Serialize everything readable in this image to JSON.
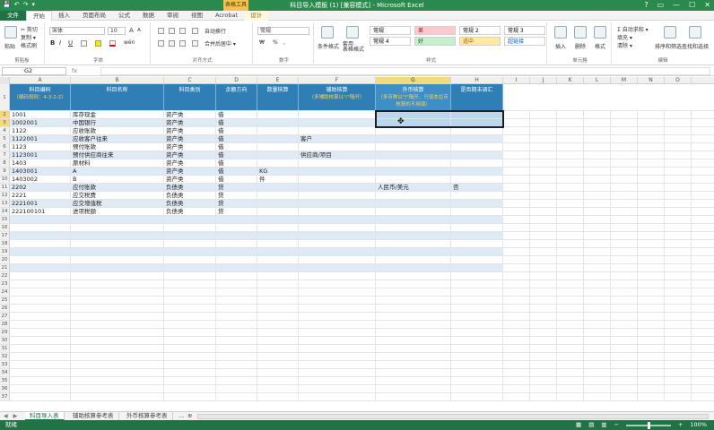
{
  "window": {
    "title": "科目导入模板 (1) [兼容模式] - Microsoft Excel",
    "context_tab_label": "表格工具",
    "controls": [
      "?",
      "▭",
      "—",
      "☐",
      "✕"
    ],
    "qat": [
      "💾",
      "↶",
      "↷",
      "▾"
    ]
  },
  "ribbon_tabs": {
    "file": "文件",
    "items": [
      "开始",
      "插入",
      "页面布局",
      "公式",
      "数据",
      "审阅",
      "视图",
      "Acrobat",
      "设计"
    ],
    "active": "开始"
  },
  "ribbon": {
    "clipboard": {
      "paste": "粘贴",
      "cut": "✂ 剪切",
      "copy": "复制 ▾",
      "format_painter": "格式刷",
      "label": "剪贴板"
    },
    "font": {
      "name": "宋体",
      "size": "10",
      "label": "字体",
      "grow": "A",
      "shrink": "A",
      "bold": "B",
      "italic": "I",
      "underline": "U",
      "wen": "wén"
    },
    "alignment": {
      "wrap": "自动换行",
      "merge": "合并后居中 ▾",
      "label": "对齐方式"
    },
    "number": {
      "format": "常规",
      "label": "数字",
      "percent": "%",
      "comma": ",",
      "currency": "₩"
    },
    "styles": {
      "cond_format": "条件格式",
      "table_format": "套用\n表格格式",
      "cells": [
        {
          "text": "常规",
          "bg": "#ffffff",
          "fg": "#000000"
        },
        {
          "text": "差",
          "bg": "#ffc7ce",
          "fg": "#9c0006"
        },
        {
          "text": "常规 2",
          "bg": "#ffffff",
          "fg": "#000000"
        },
        {
          "text": "常规 3",
          "bg": "#ffffff",
          "fg": "#000000"
        },
        {
          "text": "常规 4",
          "bg": "#ffffff",
          "fg": "#000000"
        },
        {
          "text": "好",
          "bg": "#c6efce",
          "fg": "#006100"
        },
        {
          "text": "适中",
          "bg": "#ffeb9c",
          "fg": "#9c5700"
        },
        {
          "text": "超链接",
          "bg": "#ffffff",
          "fg": "#0563c1"
        }
      ],
      "label": "样式"
    },
    "cells": {
      "insert": "插入",
      "delete": "删除",
      "format": "格式",
      "label": "单元格"
    },
    "editing": {
      "autosum": "Σ 自动求和 ▾",
      "fill": "填充 ▾",
      "clear": "清除 ▾",
      "sort": "排序和筛选",
      "find": "查找和选择",
      "label": "编辑"
    }
  },
  "formula_bar": {
    "name_box": "G2",
    "fx": "fx",
    "value": ""
  },
  "columns": [
    "A",
    "B",
    "C",
    "D",
    "E",
    "F",
    "G",
    "H",
    "I",
    "J",
    "K",
    "L",
    "M",
    "N",
    "O"
  ],
  "selected_column": "G",
  "header_row": {
    "A": {
      "title": "科目编码",
      "sub": "（编码规则：4-3-2-2）"
    },
    "B": {
      "title": "科目名称"
    },
    "C": {
      "title": "科目类别"
    },
    "D": {
      "title": "余额方向"
    },
    "E": {
      "title": "数量核算"
    },
    "F": {
      "title": "辅助核算",
      "sub": "（多辅助核算以\"/\"隔开）"
    },
    "G": {
      "title": "外币核算",
      "sub": "（多币种以\"/\"隔开，只填本位币核算的不用填）"
    },
    "H": {
      "title": "是否期末调汇"
    }
  },
  "rows": [
    {
      "n": "2",
      "A": "1001",
      "B": "库存现金",
      "C": "资产类",
      "D": "借",
      "E": "",
      "F": "",
      "G": "",
      "H": ""
    },
    {
      "n": "3",
      "A": "1002001",
      "B": "中国银行",
      "C": "资产类",
      "D": "借",
      "E": "",
      "F": "",
      "G": "",
      "H": ""
    },
    {
      "n": "4",
      "A": "1122",
      "B": "应收账款",
      "C": "资产类",
      "D": "借",
      "E": "",
      "F": "",
      "G": "",
      "H": ""
    },
    {
      "n": "5",
      "A": "1122001",
      "B": "应收客户往来",
      "C": "资产类",
      "D": "借",
      "E": "",
      "F": "客户",
      "G": "",
      "H": ""
    },
    {
      "n": "6",
      "A": "1123",
      "B": "预付账款",
      "C": "资产类",
      "D": "借",
      "E": "",
      "F": "",
      "G": "",
      "H": ""
    },
    {
      "n": "7",
      "A": "1123001",
      "B": "预付供应商往来",
      "C": "资产类",
      "D": "借",
      "E": "",
      "F": "供应商/项目",
      "G": "",
      "H": ""
    },
    {
      "n": "8",
      "A": "1403",
      "B": "原材料",
      "C": "资产类",
      "D": "借",
      "E": "",
      "F": "",
      "G": "",
      "H": ""
    },
    {
      "n": "9",
      "A": "1403001",
      "B": "A",
      "C": "资产类",
      "D": "借",
      "E": "KG",
      "F": "",
      "G": "",
      "H": ""
    },
    {
      "n": "10",
      "A": "1403002",
      "B": "B",
      "C": "资产类",
      "D": "借",
      "E": "件",
      "F": "",
      "G": "",
      "H": ""
    },
    {
      "n": "11",
      "A": "2202",
      "B": "应付账款",
      "C": "负债类",
      "D": "贷",
      "E": "",
      "F": "",
      "G": "人民币/美元",
      "H": "否"
    },
    {
      "n": "12",
      "A": "2221",
      "B": "应交税费",
      "C": "负债类",
      "D": "贷",
      "E": "",
      "F": "",
      "G": "",
      "H": ""
    },
    {
      "n": "13",
      "A": "2221001",
      "B": "应交增值税",
      "C": "负债类",
      "D": "贷",
      "E": "",
      "F": "",
      "G": "",
      "H": ""
    },
    {
      "n": "14",
      "A": "222100101",
      "B": "进项税额",
      "C": "负债类",
      "D": "贷",
      "E": "",
      "F": "",
      "G": "",
      "H": ""
    },
    {
      "n": "15"
    },
    {
      "n": "16"
    },
    {
      "n": "17"
    },
    {
      "n": "18"
    },
    {
      "n": "19"
    },
    {
      "n": "20"
    },
    {
      "n": "21"
    },
    {
      "n": "22"
    },
    {
      "n": "23"
    },
    {
      "n": "24"
    },
    {
      "n": "25"
    },
    {
      "n": "26"
    },
    {
      "n": "27"
    },
    {
      "n": "28"
    },
    {
      "n": "29"
    },
    {
      "n": "30"
    },
    {
      "n": "31"
    },
    {
      "n": "32"
    },
    {
      "n": "33"
    },
    {
      "n": "34"
    },
    {
      "n": "35"
    },
    {
      "n": "36"
    },
    {
      "n": "37"
    }
  ],
  "sheets": {
    "nav": [
      "◀",
      "▶"
    ],
    "tabs": [
      "科目导入表",
      "辅助核算参考表",
      "外币核算参考表"
    ],
    "more": "…",
    "add": "⊕",
    "active": 0
  },
  "status": {
    "left": "就绪",
    "zoom": "100%"
  },
  "colors": {
    "excel_green": "#217346",
    "header_blue": "#2f7fb6",
    "band": "#deeaf6",
    "select_orange": "#f6d97a"
  }
}
